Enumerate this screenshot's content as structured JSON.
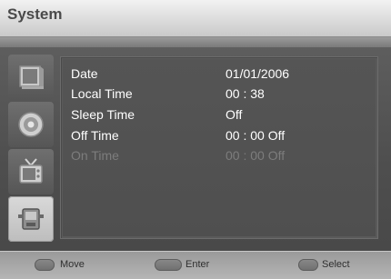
{
  "window": {
    "title": "System"
  },
  "sidebar": {
    "items": [
      {
        "name": "picture-menu",
        "icon": "monitor-icon",
        "active": false
      },
      {
        "name": "sound-menu",
        "icon": "speaker-icon",
        "active": false
      },
      {
        "name": "channel-menu",
        "icon": "tv-icon",
        "active": false
      },
      {
        "name": "system-menu",
        "icon": "setup-icon",
        "active": true
      }
    ]
  },
  "settings": [
    {
      "label": "Date",
      "value": "01/01/2006",
      "enabled": true
    },
    {
      "label": "Local Time",
      "value": "00 : 38",
      "enabled": true
    },
    {
      "label": "Sleep Time",
      "value": "Off",
      "enabled": true
    },
    {
      "label": "Off Time",
      "value": "00 : 00  Off",
      "enabled": true
    },
    {
      "label": "On Time",
      "value": "00 : 00  Off",
      "enabled": false
    }
  ],
  "footer": {
    "move": "Move",
    "enter": "Enter",
    "select": "Select"
  }
}
